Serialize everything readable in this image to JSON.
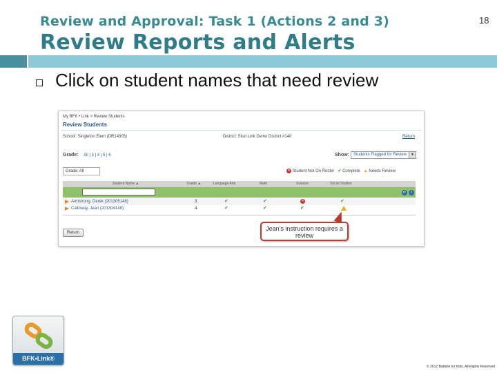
{
  "slide": {
    "subtitle": "Review and Approval: Task 1 (Actions 2 and 3)",
    "page_number": "18",
    "title": "Review Reports and Alerts",
    "bullet": "Click on student names that need review",
    "footer": "© 2012 Battelle for Kids. All Rights Reserved",
    "logo_text": "BFK•Link®",
    "accent_color": "#2f7d88",
    "band_color": "#8cc9d9"
  },
  "screenshot": {
    "breadcrumb": "My BFK • Link > Review Students",
    "page_title": "Review Students",
    "school": "School: Singleton Elem (DR14305)",
    "district": "District: Stud Link Demo District #140",
    "return_link": "Return",
    "grade_label": "Grade:",
    "grade_links": "All | 3 | 4 | 5 | 6",
    "show_label": "Show:",
    "show_value": "Students Flagged for Review",
    "grade_select": "Grade: All",
    "legend": {
      "not_on_roster": "Student Not On Roster",
      "complete": "Complete",
      "needs_review": "Needs Review"
    },
    "columns": [
      "Student Name ▲",
      "Grade ▲",
      "Language Arts",
      "Math",
      "Science",
      "Social Studies"
    ],
    "rows": [
      {
        "name": "Armstrong, Derek (201305148)",
        "grade": "3"
      },
      {
        "name": "Calloway, Jean (201304148)",
        "grade": "4"
      }
    ],
    "return_button": "Return",
    "callout": "Jean's instruction requires a review"
  }
}
